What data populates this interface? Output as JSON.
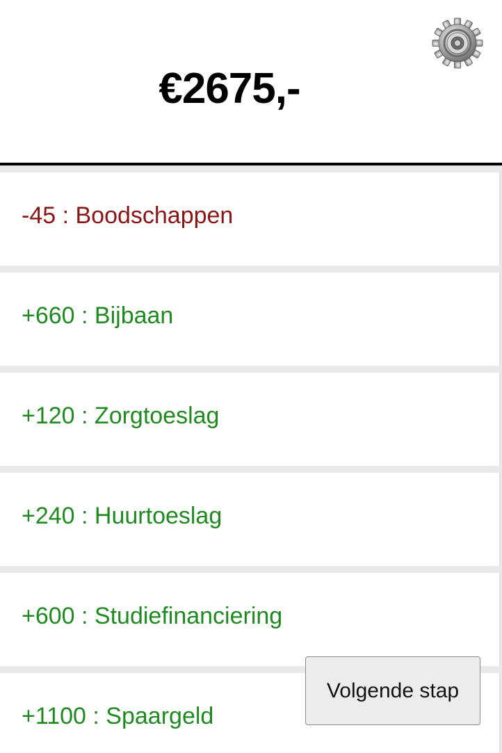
{
  "header": {
    "balance": "€2675,-",
    "settings_icon": "gear-icon"
  },
  "colors": {
    "expense": "#8b1414",
    "income": "#1f8a1f",
    "divider": "#000000",
    "separator": "#e9e9e9"
  },
  "transactions": [
    {
      "text": "-45 : Boodschappen",
      "type": "expense"
    },
    {
      "text": "+660 : Bijbaan",
      "type": "income"
    },
    {
      "text": "+120 : Zorgtoeslag",
      "type": "income"
    },
    {
      "text": "+240 : Huurtoeslag",
      "type": "income"
    },
    {
      "text": "+600 : Studiefinanciering",
      "type": "income"
    },
    {
      "text": "+1100 : Spaargeld",
      "type": "income"
    }
  ],
  "actions": {
    "next_label": "Volgende stap"
  }
}
